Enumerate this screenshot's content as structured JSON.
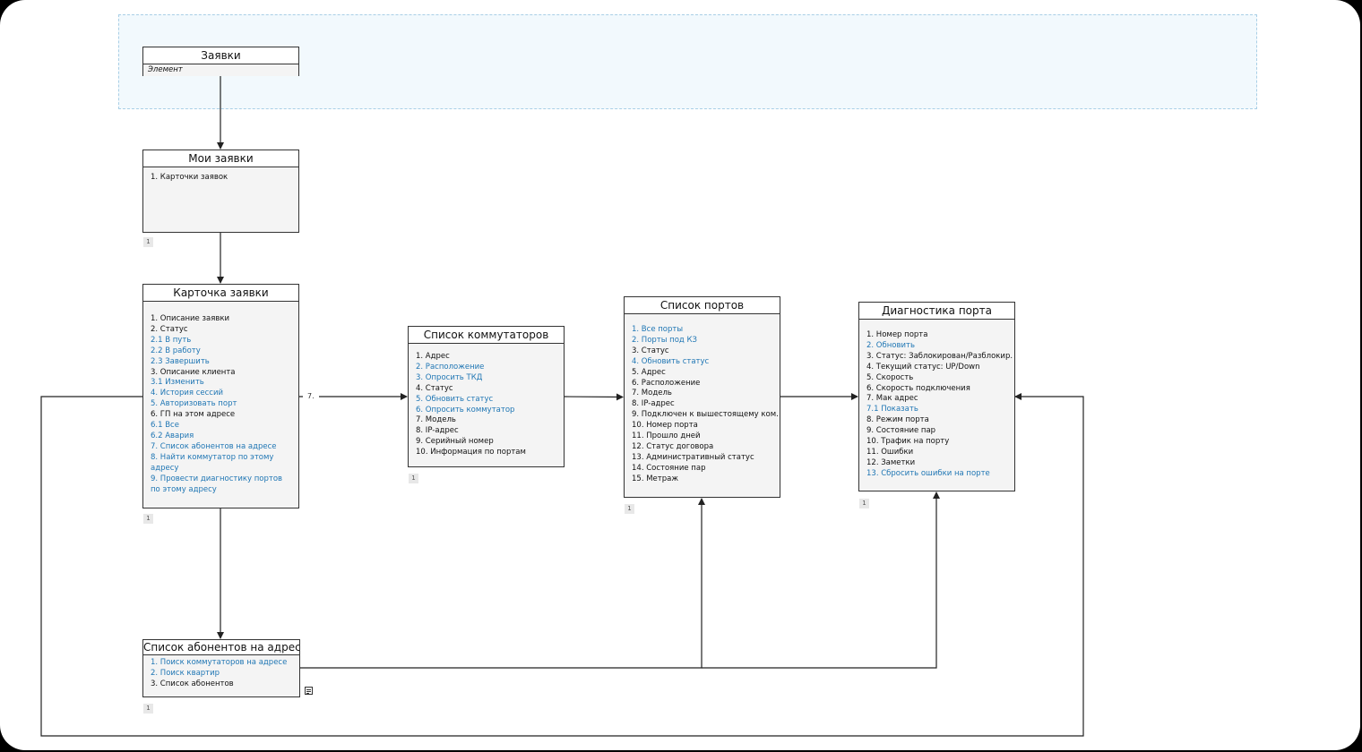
{
  "nodes": {
    "zayavki": {
      "title": "Заявки",
      "subtitle": "Элемент"
    },
    "moi": {
      "title": "Мои заявки",
      "badge": "1",
      "items": [
        {
          "text": "1.  Карточки заявок",
          "link": false
        }
      ]
    },
    "kartochka": {
      "title": "Карточка заявки",
      "badge": "1",
      "items": [
        {
          "text": "1.  Описание заявки",
          "link": false
        },
        {
          "text": "2.  Статус",
          "link": false
        },
        {
          "text": "2.1 В путь",
          "link": true
        },
        {
          "text": "2.2 В работу",
          "link": true
        },
        {
          "text": "2.3 Завершить",
          "link": true
        },
        {
          "text": "3.  Описание клиента",
          "link": false
        },
        {
          "text": "3.1 Изменить",
          "link": true
        },
        {
          "text": "4. История сессий",
          "link": true
        },
        {
          "text": "5. Авторизовать порт",
          "link": true
        },
        {
          "text": "6.  ГП на этом адресе",
          "link": false
        },
        {
          "text": "6.1 Все",
          "link": true
        },
        {
          "text": "6.2 Авария",
          "link": true
        },
        {
          "text": "7.  Список абонентов на адресе",
          "link": true
        },
        {
          "text": "8.  Найти коммутатор по этому адресу",
          "link": true,
          "wrap": true
        },
        {
          "text": "9.  Провести диагностику портов по этому адресу",
          "link": true,
          "wrap": true
        }
      ]
    },
    "kommutatory": {
      "title": "Список коммутаторов",
      "badge": "1",
      "items": [
        {
          "text": "1.  Адрес",
          "link": false
        },
        {
          "text": "2.  Расположение",
          "link": true
        },
        {
          "text": "3.  Опросить ТКД",
          "link": true
        },
        {
          "text": "4.  Статус",
          "link": false
        },
        {
          "text": "5.  Обновить статус",
          "link": true
        },
        {
          "text": "6.  Опросить коммутатор",
          "link": true
        },
        {
          "text": "7.  Модель",
          "link": false
        },
        {
          "text": "8.  IP-адрес",
          "link": false
        },
        {
          "text": "9.  Серийный номер",
          "link": false
        },
        {
          "text": "10.  Информация по портам",
          "link": false
        }
      ]
    },
    "porty": {
      "title": "Список портов",
      "badge": "1",
      "items": [
        {
          "text": "1.  Все порты",
          "link": true
        },
        {
          "text": "2.  Порты под КЗ",
          "link": true
        },
        {
          "text": "3.  Статус",
          "link": false
        },
        {
          "text": "4.  Обновить статус",
          "link": true
        },
        {
          "text": "5.  Адрес",
          "link": false
        },
        {
          "text": "6.  Расположение",
          "link": false
        },
        {
          "text": "7.  Модель",
          "link": false
        },
        {
          "text": "8.  IP-адрес",
          "link": false
        },
        {
          "text": "9.  Подключен к вышестоящему ком.",
          "link": false
        },
        {
          "text": "10.  Номер порта",
          "link": false
        },
        {
          "text": "11.  Прошло дней",
          "link": false
        },
        {
          "text": "12.  Статус договора",
          "link": false
        },
        {
          "text": "13.  Административный статус",
          "link": false
        },
        {
          "text": "14.  Состояние пар",
          "link": false
        },
        {
          "text": "15.  Метраж",
          "link": false
        }
      ]
    },
    "diagnostika": {
      "title": "Диагностика порта",
      "badge": "1",
      "items": [
        {
          "text": "1.  Номер порта",
          "link": false
        },
        {
          "text": "2.  Обновить",
          "link": true
        },
        {
          "text": "3.  Статус: Заблокирован/Разблокир.",
          "link": false
        },
        {
          "text": "4.  Текущий статус: UP/Down",
          "link": false
        },
        {
          "text": "5.  Скорость",
          "link": false
        },
        {
          "text": "6.  Скорость подключения",
          "link": false
        },
        {
          "text": "7.  Мак адрес",
          "link": false
        },
        {
          "text": "7.1 Показать",
          "link": true
        },
        {
          "text": "8.  Режим порта",
          "link": false
        },
        {
          "text": "9.  Состояние пар",
          "link": false
        },
        {
          "text": "10.  Трафик на порту",
          "link": false
        },
        {
          "text": "11.  Ошибки",
          "link": false
        },
        {
          "text": "12.  Заметки",
          "link": false
        },
        {
          "text": "13.  Сбросить ошибки на порте",
          "link": true
        }
      ]
    },
    "abonenty": {
      "title": "Список абонентов на адресе",
      "badge": "1",
      "items": [
        {
          "text": "1.  Поиск коммутаторов на адресе",
          "link": true
        },
        {
          "text": "2.  Поиск квартир",
          "link": true
        },
        {
          "text": "3.  Список абонентов",
          "link": false
        }
      ]
    }
  },
  "edges": {
    "label_7": "7."
  },
  "colors": {
    "link": "#1f76b4",
    "zone_fill": "#f2f9fd",
    "zone_border": "#a9cfe6",
    "node_fill": "#f4f4f4"
  }
}
